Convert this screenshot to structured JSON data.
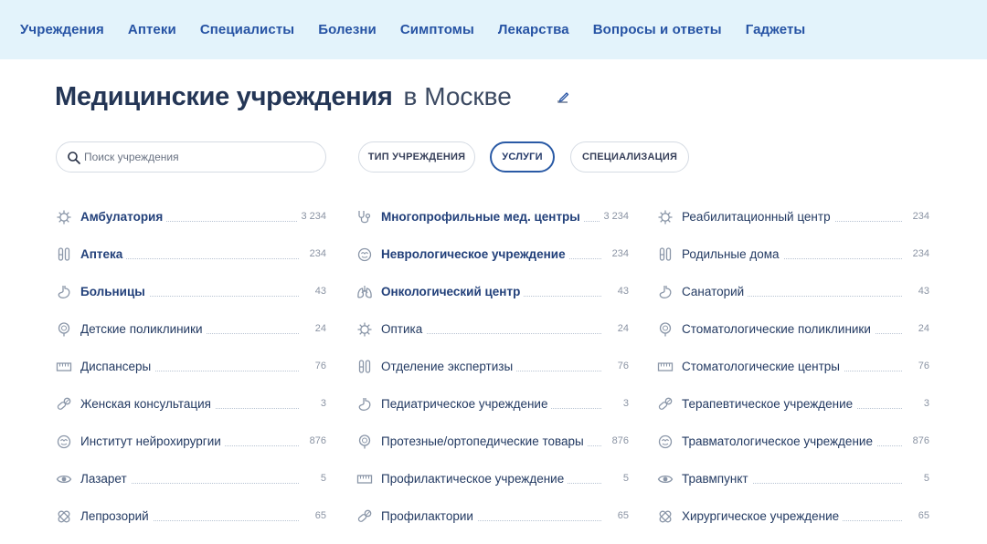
{
  "nav": [
    "Учреждения",
    "Аптеки",
    "Специалисты",
    "Болезни",
    "Симптомы",
    "Лекарства",
    "Вопросы и ответы",
    "Гаджеты"
  ],
  "heading": {
    "title": "Медицинские учреждения",
    "city": "в Москве"
  },
  "search": {
    "placeholder": "Поиск учреждения"
  },
  "filters": [
    {
      "label": "ТИП УЧРЕЖДЕНИЯ",
      "active": false
    },
    {
      "label": "УСЛУГИ",
      "active": true
    },
    {
      "label": "СПЕЦИАЛИЗАЦИЯ",
      "active": false
    }
  ],
  "colors": {
    "nav_bg": "#e3f3fb",
    "accent": "#2653a4",
    "heading": "#243656"
  },
  "columns": [
    [
      {
        "label": "Амбулатория",
        "count": "3 234",
        "bold": true,
        "icon": "virus-icon"
      },
      {
        "label": "Аптека",
        "count": "234",
        "bold": true,
        "icon": "test-tubes-icon"
      },
      {
        "label": "Больницы",
        "count": "43",
        "bold": true,
        "icon": "stomach-icon"
      },
      {
        "label": "Детские поликлиники",
        "count": "24",
        "bold": false,
        "icon": "tooth-icon"
      },
      {
        "label": "Диспансеры",
        "count": "76",
        "bold": false,
        "icon": "ruler-icon"
      },
      {
        "label": "Женская консультация",
        "count": "3",
        "bold": false,
        "icon": "pills-icon"
      },
      {
        "label": "Институт нейрохирургии",
        "count": "876",
        "bold": false,
        "icon": "brain-icon"
      },
      {
        "label": "Лазарет",
        "count": "5",
        "bold": false,
        "icon": "eye-icon"
      },
      {
        "label": "Лепрозорий",
        "count": "65",
        "bold": false,
        "icon": "bandage-icon"
      }
    ],
    [
      {
        "label": "Многопрофильные мед. центры",
        "count": "3 234",
        "bold": true,
        "icon": "stethoscope-icon"
      },
      {
        "label": "Неврологическое учреждение",
        "count": "234",
        "bold": true,
        "icon": "brain-icon"
      },
      {
        "label": "Онкологический центр",
        "count": "43",
        "bold": true,
        "icon": "lungs-icon"
      },
      {
        "label": "Оптика",
        "count": "24",
        "bold": false,
        "icon": "virus-icon"
      },
      {
        "label": "Отделение экспертизы",
        "count": "76",
        "bold": false,
        "icon": "test-tubes-icon"
      },
      {
        "label": "Педиатрическое учреждение",
        "count": "3",
        "bold": false,
        "icon": "stomach-icon"
      },
      {
        "label": "Протезные/ортопедические товары",
        "count": "876",
        "bold": false,
        "icon": "tooth-icon"
      },
      {
        "label": "Профилактическое учреждение",
        "count": "5",
        "bold": false,
        "icon": "ruler-icon"
      },
      {
        "label": "Профилактории",
        "count": "65",
        "bold": false,
        "icon": "pills-icon"
      }
    ],
    [
      {
        "label": "Реабилитационный центр",
        "count": "234",
        "bold": false,
        "icon": "virus-icon"
      },
      {
        "label": "Родильные дома",
        "count": "234",
        "bold": false,
        "icon": "test-tubes-icon"
      },
      {
        "label": "Санаторий",
        "count": "43",
        "bold": false,
        "icon": "stomach-icon"
      },
      {
        "label": "Стоматологические поликлиники",
        "count": "24",
        "bold": false,
        "icon": "tooth-icon"
      },
      {
        "label": "Стоматологические центры",
        "count": "76",
        "bold": false,
        "icon": "ruler-icon"
      },
      {
        "label": "Терапевтическое учреждение",
        "count": "3",
        "bold": false,
        "icon": "pills-icon"
      },
      {
        "label": "Травматологическое учреждение",
        "count": "876",
        "bold": false,
        "icon": "brain-icon"
      },
      {
        "label": "Травмпункт",
        "count": "5",
        "bold": false,
        "icon": "eye-icon"
      },
      {
        "label": "Хирургическое учреждение",
        "count": "65",
        "bold": false,
        "icon": "bandage-icon"
      }
    ]
  ]
}
